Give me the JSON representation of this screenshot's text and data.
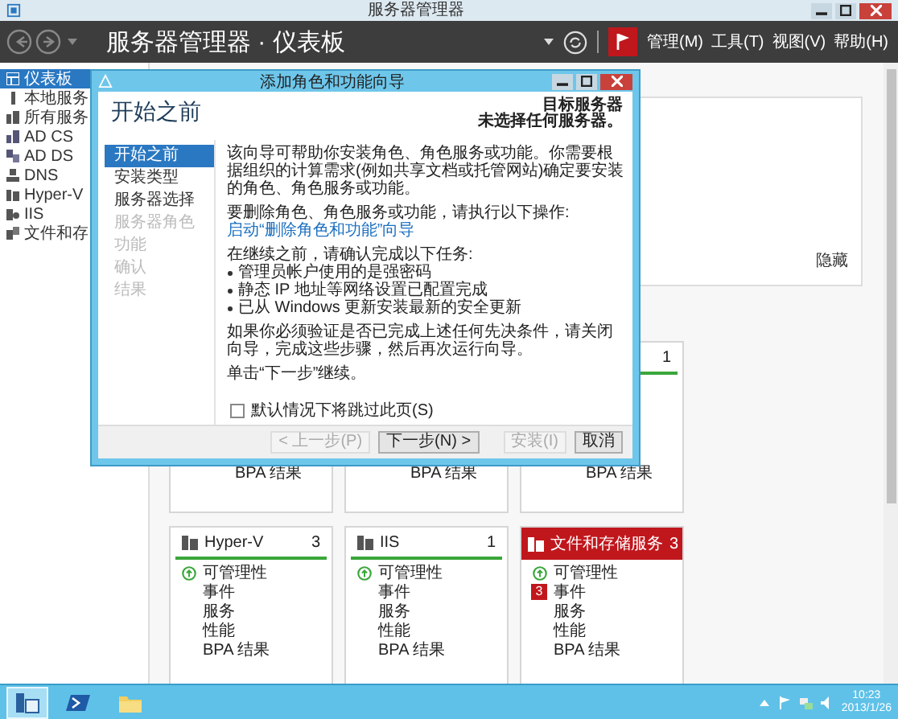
{
  "window": {
    "title": "服务器管理器"
  },
  "header": {
    "title": "服务器管理器 · 仪表板",
    "menus": [
      "管理(M)",
      "工具(T)",
      "视图(V)",
      "帮助(H)"
    ]
  },
  "sidebar": {
    "items": [
      {
        "label": "仪表板",
        "selected": true
      },
      {
        "label": "本地服务",
        "selected": false
      },
      {
        "label": "所有服务",
        "selected": false
      },
      {
        "label": "AD CS",
        "selected": false
      },
      {
        "label": "AD DS",
        "selected": false
      },
      {
        "label": "DNS",
        "selected": false
      },
      {
        "label": "Hyper-V",
        "selected": false
      },
      {
        "label": "IIS",
        "selected": false
      },
      {
        "label": "文件和存",
        "selected": false
      }
    ]
  },
  "welcome": {
    "hide_link": "隐藏"
  },
  "tile_rows": [
    {
      "tiles": [
        {
          "items": [
            {
              "label": "BPA 结果"
            }
          ]
        },
        {
          "items": [
            {
              "label": "BPA 结果"
            }
          ]
        },
        {
          "count": "1",
          "alert": false,
          "items": [
            {
              "label": "BPA 结果"
            }
          ]
        }
      ]
    },
    {
      "tiles": [
        {
          "title": "Hyper-V",
          "count": "3",
          "alert": false,
          "items": [
            {
              "label": "可管理性",
              "kind": "ok"
            },
            {
              "label": "事件"
            },
            {
              "label": "服务"
            },
            {
              "label": "性能"
            },
            {
              "label": "BPA 结果"
            }
          ]
        },
        {
          "title": "IIS",
          "count": "1",
          "alert": false,
          "items": [
            {
              "label": "可管理性",
              "kind": "ok"
            },
            {
              "label": "事件"
            },
            {
              "label": "服务"
            },
            {
              "label": "性能"
            },
            {
              "label": "BPA 结果"
            }
          ]
        },
        {
          "title": "文件和存储服务",
          "count": "3",
          "alert": true,
          "items": [
            {
              "label": "可管理性",
              "kind": "ok"
            },
            {
              "label": "事件",
              "kind": "alert",
              "badge": "3"
            },
            {
              "label": "服务"
            },
            {
              "label": "性能"
            },
            {
              "label": "BPA 结果"
            }
          ]
        }
      ]
    }
  ],
  "dialog": {
    "title": "添加角色和功能向导",
    "heading": "开始之前",
    "target_label": "目标服务器",
    "target_value": "未选择任何服务器。",
    "steps": [
      {
        "label": "开始之前",
        "selected": true,
        "disabled": false
      },
      {
        "label": "安装类型",
        "selected": false,
        "disabled": false
      },
      {
        "label": "服务器选择",
        "selected": false,
        "disabled": false
      },
      {
        "label": "服务器角色",
        "selected": false,
        "disabled": true
      },
      {
        "label": "功能",
        "selected": false,
        "disabled": true
      },
      {
        "label": "确认",
        "selected": false,
        "disabled": true
      },
      {
        "label": "结果",
        "selected": false,
        "disabled": true
      }
    ],
    "content": [
      {
        "kind": "text",
        "text": "该向导可帮助你安装角色、角色服务或功能。你需要根据组织的计算需求(例如共享文档或托管网站)确定要安装的角色、角色服务或功能。"
      },
      {
        "kind": "text",
        "text": "要删除角色、角色服务或功能，请执行以下操作:"
      },
      {
        "kind": "link",
        "text": "启动“删除角色和功能”向导"
      },
      {
        "kind": "text",
        "text": "在继续之前，请确认完成以下任务:"
      },
      {
        "kind": "bullet",
        "text": "管理员帐户使用的是强密码"
      },
      {
        "kind": "bullet",
        "text": "静态 IP 地址等网络设置已配置完成"
      },
      {
        "kind": "bullet",
        "text": "已从 Windows 更新安装最新的安全更新"
      },
      {
        "kind": "text",
        "text": "如果你必须验证是否已完成上述任何先决条件，请关闭向导，完成这些步骤，然后再次运行向导。"
      },
      {
        "kind": "text",
        "text": "单击“下一步”继续。"
      }
    ],
    "skip_checkbox": {
      "label": "默认情况下将跳过此页(S)",
      "checked": false
    },
    "buttons": [
      {
        "label": "< 上一步(P)",
        "disabled": true
      },
      {
        "label": "下一步(N) >",
        "disabled": false
      },
      {
        "label": "安装(I)",
        "disabled": true
      },
      {
        "label": "取消",
        "disabled": false
      }
    ]
  },
  "taskbar": {
    "apps": [
      {
        "kind": "server-manager",
        "selected": true
      },
      {
        "kind": "powershell",
        "selected": false
      },
      {
        "kind": "explorer",
        "selected": false
      }
    ],
    "time": "10:23",
    "date": "2013/1/26"
  }
}
